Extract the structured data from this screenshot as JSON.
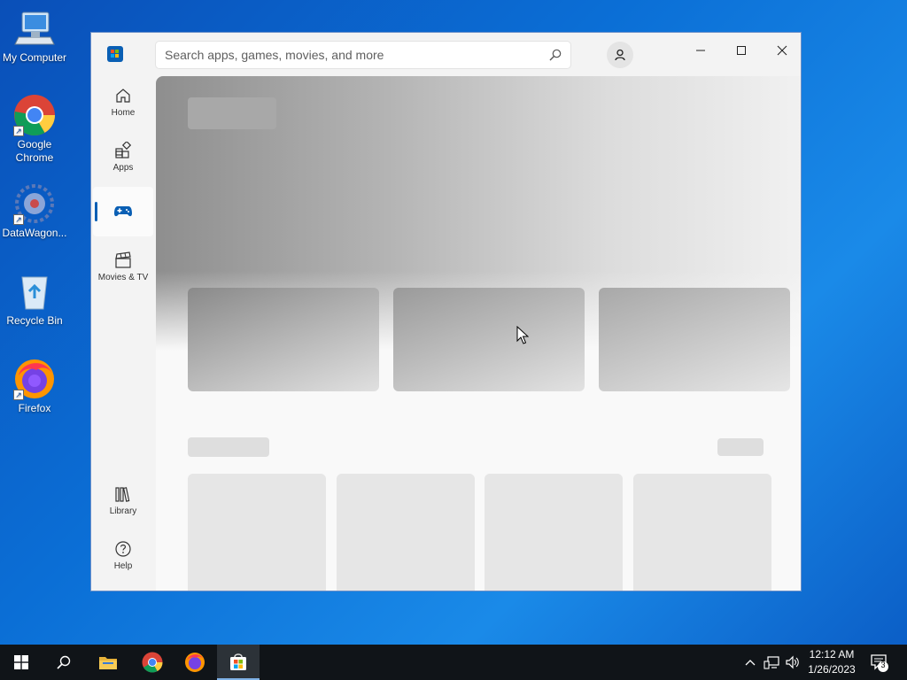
{
  "desktop": {
    "icons": [
      {
        "label": "My Computer"
      },
      {
        "label": "Google Chrome"
      },
      {
        "label": "DataWagon..."
      },
      {
        "label": "Recycle Bin"
      },
      {
        "label": "Firefox"
      }
    ]
  },
  "store": {
    "search_placeholder": "Search apps, games, movies, and more",
    "nav": [
      {
        "label": "Home",
        "icon": "home-icon"
      },
      {
        "label": "Apps",
        "icon": "apps-icon"
      },
      {
        "label": "",
        "icon": "gamepad-icon",
        "active": true
      },
      {
        "label": "Movies & TV",
        "icon": "clapperboard-icon"
      },
      {
        "label": "Library",
        "icon": "library-icon"
      },
      {
        "label": "Help",
        "icon": "help-icon"
      }
    ],
    "accent": "#0a5fb4"
  },
  "taskbar": {
    "time": "12:12 AM",
    "date": "1/26/2023",
    "notifications": "3"
  }
}
